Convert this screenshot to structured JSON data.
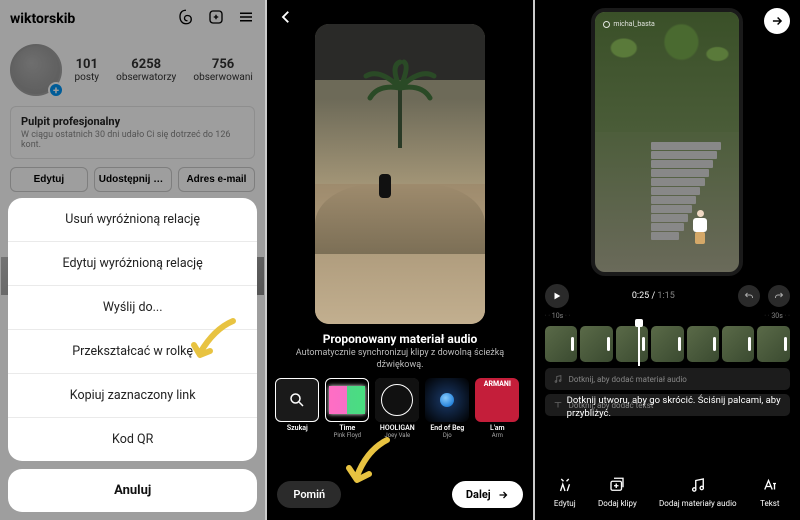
{
  "pane1": {
    "username": "wiktorskib",
    "stats": {
      "posts_n": "101",
      "posts_l": "posty",
      "followers_n": "6258",
      "followers_l": "obserwatorzy",
      "following_n": "756",
      "following_l": "obserwowani"
    },
    "pro_dash_title": "Pulpit profesjonalny",
    "pro_dash_sub": "W ciągu ostatnich 30 dni udało Ci się dotrzeć do 126 kont.",
    "btn_edit": "Edytuj",
    "btn_share": "Udostępnij pr...",
    "btn_email": "Adres e-mail",
    "sheet": {
      "delete": "Usuń wyróżnioną relację",
      "edit": "Edytuj wyróżnioną relację",
      "send": "Wyślij do...",
      "convert": "Przekształcać w rolkę",
      "copy": "Kopiuj zaznaczony link",
      "qr": "Kod QR",
      "cancel": "Anuluj"
    }
  },
  "pane2": {
    "audio_title": "Proponowany materiał audio",
    "audio_sub": "Automatycznie synchronizuj klipy z dowolną ścieżką dźwiękową.",
    "cards": {
      "search": "Szukaj",
      "c1_t": "Time",
      "c1_a": "Pink Floyd",
      "c2_t": "HOOLIGAN",
      "c2_a": "Joey Vale",
      "c3_t": "End of Beg",
      "c3_a": "Djo",
      "c4_t": "L'am",
      "c4_a": "Arm"
    },
    "arm_label": "ARMANI",
    "skip": "Pomiń",
    "next": "Dalej"
  },
  "pane3": {
    "watermark": "michal_basta",
    "time_cur": "0:25",
    "time_tot": "1:15",
    "ruler_a": "10s",
    "ruler_b": "30s",
    "track_audio": "Dotknij, aby dodać materiał audio",
    "track_text": "Dotknij, aby dodać tekst",
    "hint": "Dotknij utworu, aby go skrócić. Ściśnij palcami, aby przybliżyć.",
    "tb_edit": "Edytuj",
    "tb_add": "Dodaj klipy",
    "tb_audio": "Dodaj materiały audio",
    "tb_text": "Tekst"
  }
}
